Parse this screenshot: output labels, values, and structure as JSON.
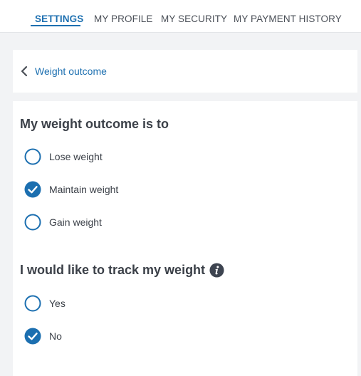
{
  "nav": {
    "tabs": [
      {
        "label": "SETTINGS",
        "active": true
      },
      {
        "label": "MY PROFILE",
        "active": false
      },
      {
        "label": "MY SECURITY",
        "active": false
      },
      {
        "label": "MY PAYMENT HISTORY",
        "active": false
      }
    ]
  },
  "breadcrumb": {
    "back_label": "Weight outcome",
    "icon": "chevron-left-icon"
  },
  "outcome": {
    "title": "My weight outcome is to",
    "options": [
      {
        "label": "Lose weight",
        "selected": false
      },
      {
        "label": "Maintain weight",
        "selected": true
      },
      {
        "label": "Gain weight",
        "selected": false
      }
    ]
  },
  "tracking": {
    "title": "I would like to track my weight",
    "info_icon": "info-icon",
    "options": [
      {
        "label": "Yes",
        "selected": false
      },
      {
        "label": "No",
        "selected": true
      }
    ]
  },
  "colors": {
    "accent": "#1c6fb0",
    "text": "#3b4048",
    "background": "#f2f3f5",
    "panel": "#ffffff"
  }
}
